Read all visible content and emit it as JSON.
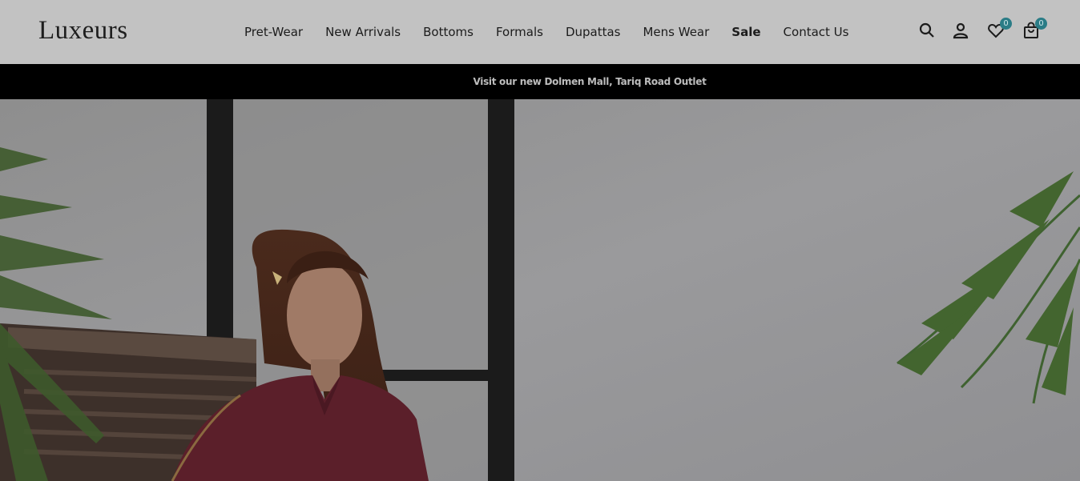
{
  "brand": {
    "logo_text": "Luxeurs"
  },
  "nav": {
    "items": [
      {
        "label": "Pret-Wear",
        "bold": false
      },
      {
        "label": "New Arrivals",
        "bold": false
      },
      {
        "label": "Bottoms",
        "bold": false
      },
      {
        "label": "Formals",
        "bold": false
      },
      {
        "label": "Dupattas",
        "bold": false
      },
      {
        "label": "Mens Wear",
        "bold": false
      },
      {
        "label": "Sale",
        "bold": true
      },
      {
        "label": "Contact Us",
        "bold": false
      }
    ]
  },
  "header_icons": {
    "search": "search-icon",
    "account": "user-icon",
    "wishlist": "heart-icon",
    "wishlist_count": "0",
    "cart": "shopping-bag-icon",
    "cart_count": "0"
  },
  "announcement": {
    "text": "Visit our new Dolmen Mall, Tariq Road Outlet"
  },
  "hero": {
    "image": "woman-in-maroon-kurta-photo"
  },
  "colors": {
    "badge": "#2a7c86",
    "announcement_bg": "#000000",
    "header_bg": "#c2c2c2"
  }
}
